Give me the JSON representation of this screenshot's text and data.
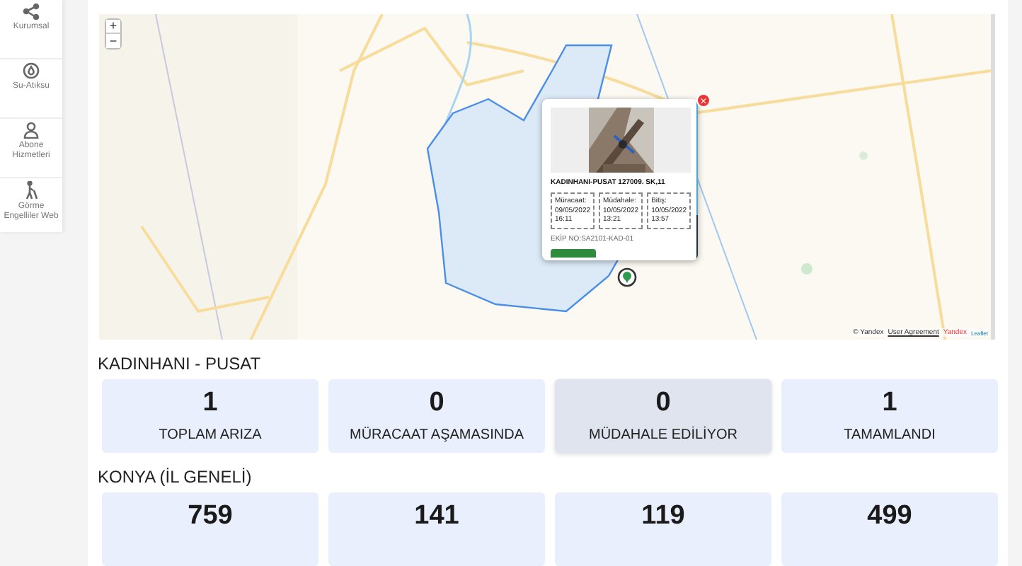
{
  "sidebar": {
    "items": [
      {
        "label": "Kurumsal"
      },
      {
        "label": "Su-Atıksu"
      },
      {
        "label": "Abone Hizmetleri"
      },
      {
        "label": "Görme Engelliler Web"
      }
    ]
  },
  "map": {
    "zoom_in": "+",
    "zoom_out": "−",
    "popup": {
      "close": "×",
      "title": "KADINHANI-PUSAT 127009. SK,11",
      "dates": [
        {
          "label": "Müracaat:",
          "date": "09/05/2022",
          "time": "16:11"
        },
        {
          "label": "Müdahale:",
          "date": "10/05/2022",
          "time": "13:21"
        },
        {
          "label": "Bitiş:",
          "date": "10/05/2022",
          "time": "13:57"
        }
      ],
      "team": "EKİP NO:SA2101-KAD-01"
    },
    "attribution": {
      "copyright": "© Yandex",
      "link": "User Agreement",
      "brand": "Yandex",
      "leaflet": "Leaflet"
    }
  },
  "sections": [
    {
      "title": "KADINHANI - PUSAT",
      "cards": [
        {
          "value": "1",
          "label": "TOPLAM ARIZA",
          "highlighted": false
        },
        {
          "value": "0",
          "label": "MÜRACAAT AŞAMASINDA",
          "highlighted": false
        },
        {
          "value": "0",
          "label": "MÜDAHALE EDİLİYOR",
          "highlighted": true
        },
        {
          "value": "1",
          "label": "TAMAMLANDI",
          "highlighted": false
        }
      ]
    },
    {
      "title": "KONYA (İL GENELİ)",
      "cards": [
        {
          "value": "759",
          "highlighted": false
        },
        {
          "value": "141",
          "highlighted": false
        },
        {
          "value": "119",
          "highlighted": false
        },
        {
          "value": "499",
          "highlighted": false
        }
      ]
    }
  ]
}
